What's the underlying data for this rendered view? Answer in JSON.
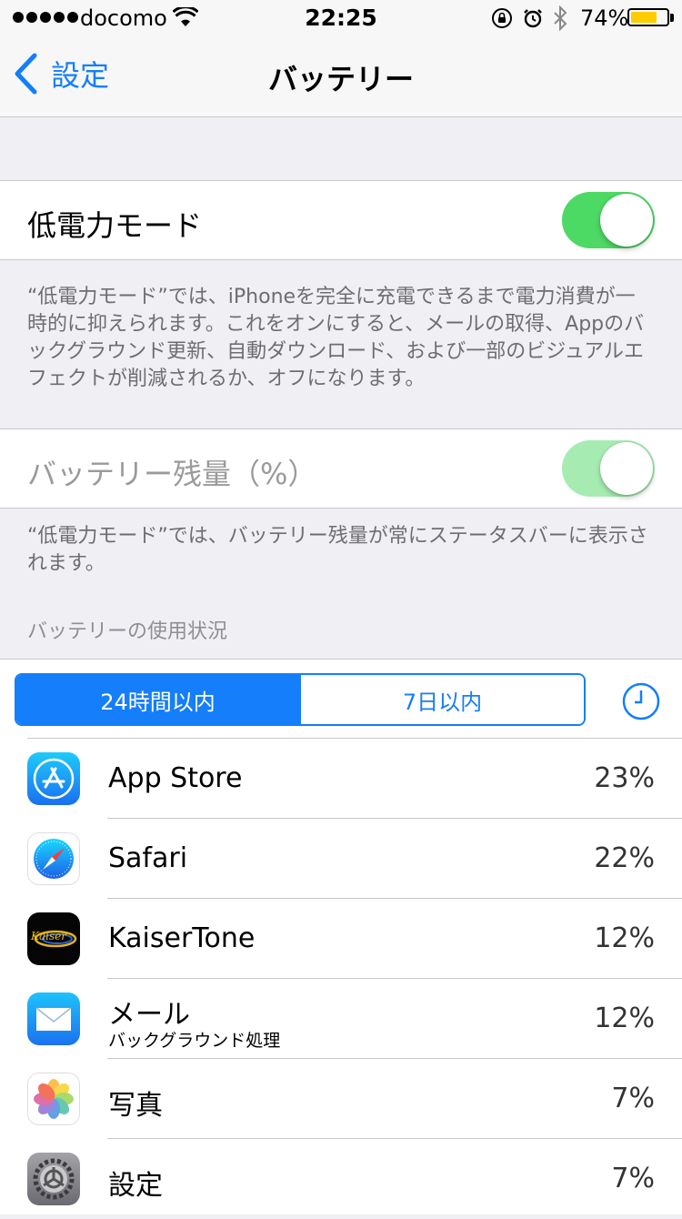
{
  "status_bar": {
    "carrier": "docomo",
    "time": "22:25",
    "battery_percent_text": "74%",
    "battery_level": 0.74
  },
  "nav": {
    "back_label": "設定",
    "title": "バッテリー"
  },
  "low_power": {
    "label": "低電力モード",
    "on": true,
    "footer": "“低電力モード”では、iPhoneを完全に充電できるまで電力消費が一時的に抑えられます。これをオンにすると、メールの取得、Appのバックグラウンド更新、自動ダウンロード、および一部のビジュアルエフェクトが削減されるか、オフになります。"
  },
  "battery_percentage": {
    "label": "バッテリー残量（%）",
    "on": true,
    "disabled": true,
    "footer": "“低電力モード”では、バッテリー残量が常にステータスバーに表示されます。"
  },
  "usage": {
    "section_header": "バッテリーの使用状況",
    "segments": [
      "24時間以内",
      "7日以内"
    ],
    "selected_segment": 0,
    "apps": [
      {
        "name": "App Store",
        "subtitle": "",
        "percent": "23%",
        "icon": "app-store-icon"
      },
      {
        "name": "Safari",
        "subtitle": "",
        "percent": "22%",
        "icon": "safari-icon"
      },
      {
        "name": "KaiserTone",
        "subtitle": "",
        "percent": "12%",
        "icon": "kaisertone-icon",
        "icon_text": "Kaiser"
      },
      {
        "name": "メール",
        "subtitle": "バックグラウンド処理",
        "percent": "12%",
        "icon": "mail-icon"
      },
      {
        "name": "写真",
        "subtitle": "",
        "percent": "7%",
        "icon": "photos-icon"
      },
      {
        "name": "設定",
        "subtitle": "",
        "percent": "7%",
        "icon": "settings-icon"
      }
    ]
  },
  "colors": {
    "accent": "#147efb",
    "switch_on": "#4cd964",
    "battery_fill": "#ffcc00",
    "grouped_background": "#efeff4"
  }
}
